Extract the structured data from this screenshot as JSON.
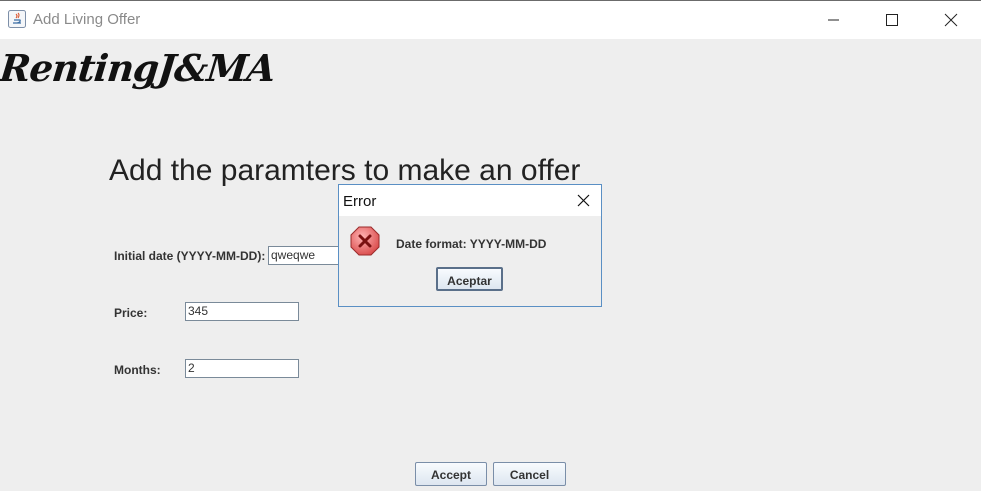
{
  "window": {
    "title": "Add Living Offer",
    "controls": [
      "minimize",
      "maximize",
      "close"
    ]
  },
  "logo": {
    "text": "RentingJ&MA"
  },
  "form": {
    "heading": "Add the paramters to make an offer",
    "fields": [
      {
        "label": "Initial date (YYYY-MM-DD):",
        "value": "qweqwe"
      },
      {
        "label": "Price:",
        "value": "345"
      },
      {
        "label": "Months:",
        "value": "2"
      }
    ],
    "accept_label": "Accept",
    "cancel_label": "Cancel"
  },
  "dialog": {
    "title": "Error",
    "message": "Date format: YYYY-MM-DD",
    "button_label": "Aceptar",
    "icon": "error-icon"
  },
  "colors": {
    "background": "#eeeeee",
    "dialog_border": "#5a8fc4",
    "error_red": "#d94a4a"
  }
}
